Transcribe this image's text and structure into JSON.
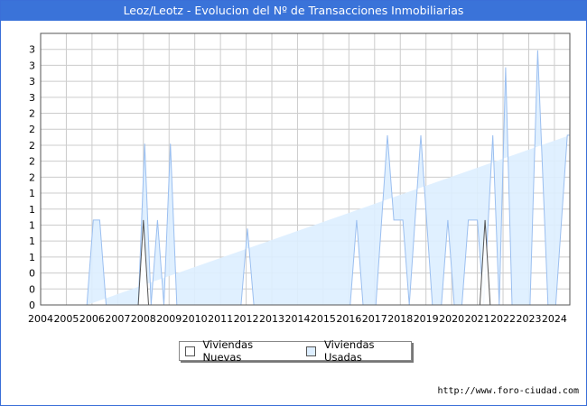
{
  "chart_data": {
    "type": "area",
    "title": "Leoz/Leotz - Evolucion del Nº de Transacciones Inmobiliarias",
    "x_tick_labels": [
      "2004",
      "2005",
      "2006",
      "2007",
      "2008",
      "2009",
      "2010",
      "2011",
      "2012",
      "2013",
      "2014",
      "2015",
      "2016",
      "2017",
      "2018",
      "2019",
      "2020",
      "2021",
      "2022",
      "2023",
      "2024"
    ],
    "y_tick_labels": [
      "0",
      "0",
      "0",
      "1",
      "1",
      "1",
      "1",
      "1",
      "2",
      "2",
      "2",
      "2",
      "2",
      "3",
      "3",
      "3",
      "3"
    ],
    "ylim": [
      0,
      3.2
    ],
    "xlim": [
      2004,
      2024.6
    ],
    "grid": true,
    "legend_position": "bottom",
    "series": [
      {
        "name": "Viviendas Nuevas",
        "color": "#ffffff",
        "stroke": "#555555",
        "points": [
          [
            2007.8,
            0
          ],
          [
            2008.0,
            1
          ],
          [
            2008.2,
            0
          ],
          [
            2021.1,
            0
          ],
          [
            2021.3,
            1
          ],
          [
            2021.5,
            0
          ]
        ]
      },
      {
        "name": "Viviendas Usadas",
        "color": "#ddeeff",
        "stroke": "#9bbff0",
        "points": [
          [
            2005.8,
            0
          ],
          [
            2006.05,
            1
          ],
          [
            2006.3,
            1
          ],
          [
            2006.55,
            0
          ],
          [
            2007.8,
            0
          ],
          [
            2008.05,
            1.9
          ],
          [
            2008.3,
            0
          ],
          [
            2008.3,
            0
          ],
          [
            2008.55,
            1
          ],
          [
            2008.8,
            0
          ],
          [
            2008.8,
            0
          ],
          [
            2009.05,
            1.9
          ],
          [
            2009.3,
            0
          ],
          [
            2011.8,
            0
          ],
          [
            2012.05,
            0.9
          ],
          [
            2012.3,
            0
          ],
          [
            2016.05,
            0
          ],
          [
            2016.3,
            1
          ],
          [
            2016.55,
            0
          ],
          [
            2017.05,
            0
          ],
          [
            2017.5,
            2
          ],
          [
            2017.75,
            1
          ],
          [
            2018.1,
            1
          ],
          [
            2018.35,
            0
          ],
          [
            2018.35,
            0
          ],
          [
            2018.8,
            2
          ],
          [
            2019.25,
            0
          ],
          [
            2019.6,
            0
          ],
          [
            2019.85,
            1
          ],
          [
            2020.1,
            0
          ],
          [
            2020.4,
            0
          ],
          [
            2020.65,
            1
          ],
          [
            2021.0,
            1
          ],
          [
            2021.25,
            0
          ],
          [
            2021.25,
            0
          ],
          [
            2021.6,
            2
          ],
          [
            2021.85,
            0
          ],
          [
            2021.85,
            0
          ],
          [
            2022.1,
            2.8
          ],
          [
            2022.35,
            0
          ],
          [
            2023.05,
            0
          ],
          [
            2023.35,
            3
          ],
          [
            2023.75,
            0
          ],
          [
            2024.05,
            0
          ],
          [
            2024.5,
            2
          ],
          [
            2024.6,
            2
          ]
        ]
      }
    ],
    "legend": [
      {
        "label": "Viviendas Nuevas",
        "swatch": "#ffffff"
      },
      {
        "label": "Viviendas Usadas",
        "swatch": "#ddeeff"
      }
    ]
  },
  "footer": {
    "url": "http://www.foro-ciudad.com"
  },
  "colors": {
    "title_bar": "#3a73d9",
    "grid": "#cccccc",
    "nuevas_fill": "#ffffff",
    "usadas_fill": "#ddeeff",
    "usadas_stroke": "#9bbff0"
  }
}
